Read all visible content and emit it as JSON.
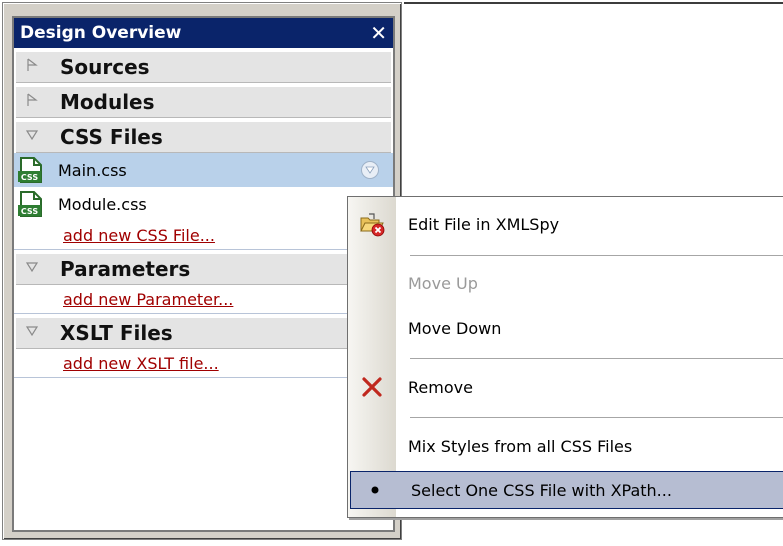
{
  "panel": {
    "title": "Design Overview",
    "close_symbol": "✕"
  },
  "sections": {
    "sources": {
      "label": "Sources",
      "state": "collapsed"
    },
    "modules": {
      "label": "Modules",
      "state": "collapsed"
    },
    "css_files": {
      "label": "CSS Files",
      "state": "expanded"
    },
    "parameters": {
      "label": "Parameters",
      "state": "expanded"
    },
    "xslt_files": {
      "label": "XSLT Files",
      "state": "expanded"
    }
  },
  "css_files": [
    {
      "name": "Main.css",
      "selected": true
    },
    {
      "name": "Module.css",
      "selected": false
    }
  ],
  "links": {
    "add_css": "add new CSS File...",
    "add_parameter": "add new Parameter...",
    "add_xslt": "add new XSLT file..."
  },
  "icons": {
    "collapsed": "triangle-right-outline-icon",
    "expanded": "triangle-down-outline-icon",
    "css_file": "css-file-icon",
    "row_menu": "circle-down-arrow-icon",
    "edit": "open-folder-with-red-x-icon",
    "remove": "red-x-icon",
    "selected_option": "bullet-icon"
  },
  "context_menu": {
    "items": [
      {
        "label": "Edit File in XMLSpy",
        "enabled": true
      },
      {
        "label": "Move Up",
        "enabled": false
      },
      {
        "label": "Move Down",
        "enabled": true
      },
      {
        "label": "Remove",
        "enabled": true
      },
      {
        "label": "Mix Styles from all CSS Files",
        "enabled": true
      },
      {
        "label": "Select One CSS File with XPath...",
        "enabled": true,
        "checked": true,
        "highlighted": true
      }
    ]
  },
  "colors": {
    "titlebar": "#0a246a",
    "selected_row": "#b9d1ea",
    "link": "#a00000",
    "menu_highlight": "#b6bdd2"
  }
}
